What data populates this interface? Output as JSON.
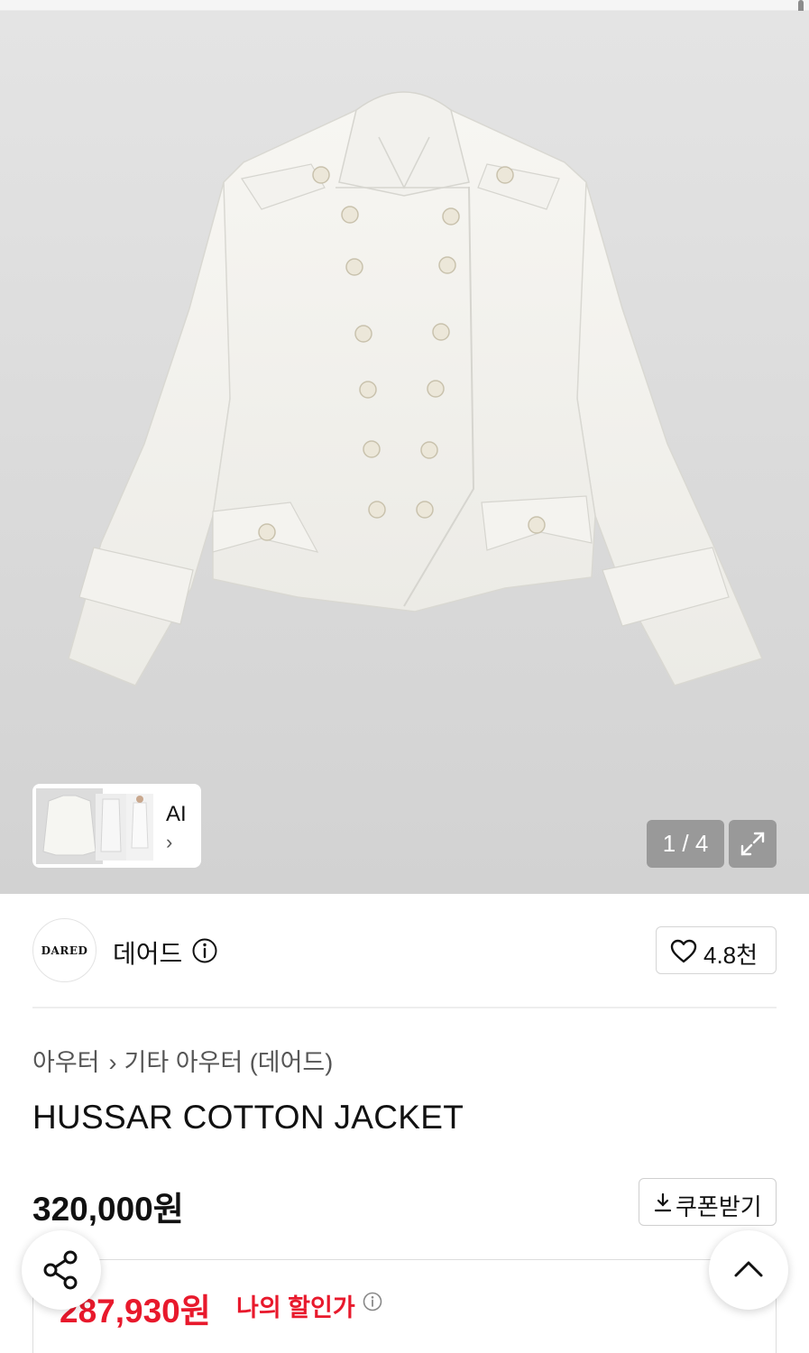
{
  "gallery": {
    "ai_label": "AI",
    "ai_chevron": "›",
    "pager": "1 / 4",
    "expand_icon": "expand-icon"
  },
  "brand": {
    "logo_text": "DARED",
    "name": "데어드",
    "info_icon": "info-icon",
    "like_icon": "heart-icon",
    "like_count": "4.8천"
  },
  "breadcrumb": {
    "category": "아우터",
    "separator": "›",
    "subcategory": "기타 아우터 (데어드)"
  },
  "product": {
    "title": "HUSSAR COTTON JACKET",
    "price": "320,000원"
  },
  "coupon": {
    "icon": "download-icon",
    "label": "쿠폰받기"
  },
  "discount": {
    "price": "287,930원",
    "label": "나의 할인가",
    "info_icon": "info-icon",
    "chevron_icon": "chevron-down-icon"
  },
  "fabs": {
    "share_icon": "share-icon",
    "top_icon": "chevron-up-icon"
  },
  "colors": {
    "accent_red": "#e8192c",
    "text": "#111111",
    "gallery_bg": "#dcdcdc"
  }
}
